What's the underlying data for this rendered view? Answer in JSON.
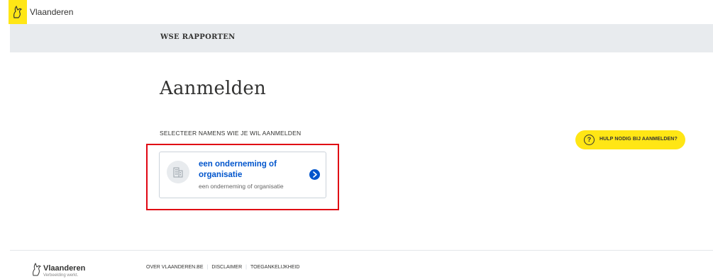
{
  "header": {
    "brand": "Vlaanderen"
  },
  "app": {
    "title": "WSE RAPPORTEN"
  },
  "main": {
    "page_title": "Aanmelden",
    "section_label": "SELECTEER NAMENS WIE JE WIL AANMELDEN",
    "card": {
      "title": "een onderneming of organisatie",
      "subtitle": "een onderneming of organisatie"
    },
    "help_button": {
      "icon_glyph": "?",
      "label": "HULP NODIG BIJ AANMELDEN?"
    }
  },
  "footer": {
    "brand": "Vlaanderen",
    "tagline": "Verbeelding werkt.",
    "links": [
      "OVER VLAANDEREN.BE",
      "DISCLAIMER",
      "TOEGANKELIJKHEID"
    ]
  },
  "colors": {
    "brand_yellow": "#ffe615",
    "link_blue": "#0055cc",
    "band_grey": "#e8ebee",
    "highlight_red": "#e00613"
  },
  "icons": [
    "flemish-lion-icon",
    "building-icon",
    "chevron-right-icon",
    "question-circle-icon"
  ]
}
